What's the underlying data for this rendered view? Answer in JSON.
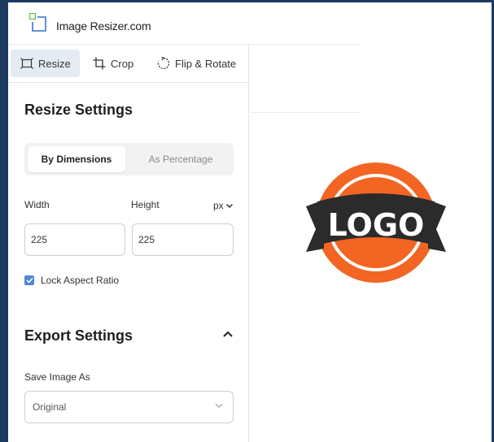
{
  "app": {
    "brand": "Image Resizer.com",
    "accent": "#4f86d6",
    "frame_color": "#1c3a5e"
  },
  "tabs": [
    {
      "label": "Resize",
      "icon": "resize-icon",
      "active": true
    },
    {
      "label": "Crop",
      "icon": "crop-icon",
      "active": false
    },
    {
      "label": "Flip & Rotate",
      "icon": "rotate-icon",
      "active": false
    }
  ],
  "resize_settings": {
    "title": "Resize Settings",
    "mode_options": [
      "By Dimensions",
      "As Percentage"
    ],
    "selected_mode": "By Dimensions",
    "width_label": "Width",
    "height_label": "Height",
    "unit": "px",
    "width_value": "225",
    "height_value": "225",
    "lock_aspect_label": "Lock Aspect Ratio",
    "lock_aspect_checked": true
  },
  "export_settings": {
    "title": "Export Settings",
    "expanded": true,
    "save_as_label": "Save Image As",
    "save_as_value": "Original"
  },
  "preview": {
    "logo_text": "LOGO",
    "circle_color": "#f26522",
    "banner_color": "#2b2b2b"
  }
}
